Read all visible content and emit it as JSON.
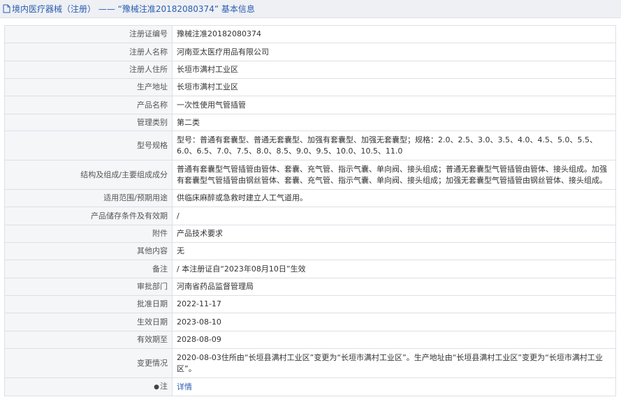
{
  "header": {
    "title": "境内医疗器械（注册） —— “豫械注准20182080374” 基本信息"
  },
  "rows": [
    {
      "label": "注册证编号",
      "value": "豫械注准20182080374",
      "h": 25
    },
    {
      "label": "注册人名称",
      "value": "河南亚太医疗用品有限公司",
      "h": 26
    },
    {
      "label": "注册人住所",
      "value": "长垣市满村工业区",
      "h": 25
    },
    {
      "label": "生产地址",
      "value": "长垣市满村工业区",
      "h": 25
    },
    {
      "label": "产品名称",
      "value": "一次性使用气管插管",
      "h": 26
    },
    {
      "label": "管理类别",
      "value": "第二类",
      "h": 24
    },
    {
      "label": "型号规格",
      "value": "型号：普通有套囊型、普通无套囊型、加强有套囊型、加强无套囊型；规格：2.0、2.5、3.0、3.5、4.0、4.5、5.0、5.5、6.0、6.5、7.0、7.5、8.0、8.5、9.0、9.5、10.0、10.5、11.0",
      "h": 42
    },
    {
      "label": "结构及组成/主要组成成分",
      "value": "普通有套囊型气管插管由管体、套囊、充气管、指示气囊、单向阀、接头组成；普通无套囊型气管插管由管体、接头组成。加强有套囊型气管插管由钢丝管体、套囊、充气管、指示气囊、单向阀、接头组成；加强无套囊型气管插管由钢丝管体、接头组成。",
      "h": 42
    },
    {
      "label": "适用范围/预期用途",
      "value": "供临床麻醉或急救时建立人工气道用。",
      "h": 25
    },
    {
      "label": "产品储存条件及有效期",
      "value": "/",
      "h": 26
    },
    {
      "label": "附件",
      "value": "产品技术要求",
      "h": 25
    },
    {
      "label": "其他内容",
      "value": "无",
      "h": 25
    },
    {
      "label": "备注",
      "value": "/ 本注册证自“2023年08月10日”生效",
      "h": 26
    },
    {
      "label": "审批部门",
      "value": "河南省药品监督管理局",
      "h": 25
    },
    {
      "label": "批准日期",
      "value": "2022-11-17",
      "h": 25
    },
    {
      "label": "生效日期",
      "value": "2023-08-10",
      "h": 26
    },
    {
      "label": "有效期至",
      "value": "2028-08-09",
      "h": 25
    },
    {
      "label": "变更情况",
      "value": "2020-08-03住所由“长垣县满村工业区”变更为“长垣市满村工业区”。生产地址由“长垣县满村工业区”变更为“长垣市满村工业区”。",
      "h": 42
    }
  ],
  "note_row": {
    "icon": "pin-icon",
    "label": "注",
    "link_text": "详情"
  }
}
